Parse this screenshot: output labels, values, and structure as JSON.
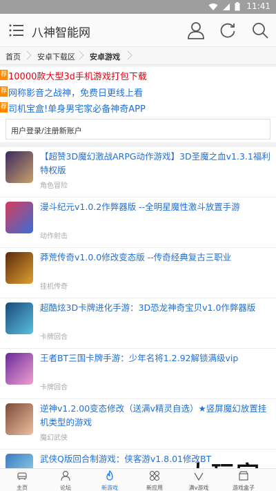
{
  "status": {
    "time": "11:41"
  },
  "appbar": {
    "title": "八神智能网"
  },
  "breadcrumb": [
    "首页",
    "安卓下载区",
    "安卓游戏"
  ],
  "ads": [
    {
      "tag": "荐",
      "text": "10000款大型3d手机游戏打包下载",
      "color": "red"
    },
    {
      "tag": "荐",
      "text": "网称影音之战神，免费日更线上看",
      "color": "blue"
    },
    {
      "tag": "荐",
      "text": "司机宝盒!单身男宅家必备神奇APP",
      "color": "blue"
    }
  ],
  "login": {
    "label": "用户登录/注册新账户"
  },
  "games": [
    {
      "name": "【超赞3D魔幻激战ARPG动作游戏】3D圣魔之血v1.3.1福利特权版",
      "category": "角色冒险",
      "colors": [
        "#3b2a5e",
        "#c9a06b"
      ]
    },
    {
      "name": "漫斗纪元v1.0.2作弊器版 --全明星魔性激斗放置手游",
      "category": "动作射击",
      "colors": [
        "#d63a5a",
        "#3a6fd6"
      ]
    },
    {
      "name": "莽荒传奇v1.0.0修改变态版 --传奇经典复古三职业",
      "category": "挂机传奇",
      "colors": [
        "#5a2a10",
        "#e0a030"
      ]
    },
    {
      "name": "超酷炫3D卡牌进化手游：3D恐龙神奇宝贝v1.0作弊器版",
      "category": "卡牌回合",
      "colors": [
        "#1a4a7a",
        "#5ac0e0"
      ]
    },
    {
      "name": "王者BT三国卡牌手游：少年名将1.2.92解锁满级vip",
      "category": "卡牌回合",
      "colors": [
        "#6a2a9a",
        "#f0a0d0"
      ]
    },
    {
      "name": "逆神v1.2.00变态修改（送满v精灵自选）★竖屏魔幻放置挂机类型的游戏",
      "category": "魔幻武侠",
      "colors": [
        "#7a4a3a",
        "#f0c0a0"
      ]
    },
    {
      "name": "武侠Q版回合制游戏：侠客游v1.8.01修改BT",
      "category": "",
      "colors": [
        "#3a7ac0",
        "#a0e0f0"
      ]
    }
  ],
  "tabs": [
    {
      "label": "主页",
      "icon": "sofa-icon"
    },
    {
      "label": "论坛",
      "icon": "user-icon"
    },
    {
      "label": "新游戏",
      "icon": "flame-icon"
    },
    {
      "label": "新应用",
      "icon": "apps-icon"
    },
    {
      "label": "满v游戏",
      "icon": "vip-icon"
    },
    {
      "label": "游戏盒子",
      "icon": "box-icon"
    }
  ],
  "watermark": "大玩家",
  "colors": {
    "accent": "#1a7cf5",
    "ad_red": "#e60012",
    "link_blue": "#1f6fd8",
    "tag_orange": "#ff8a00"
  }
}
